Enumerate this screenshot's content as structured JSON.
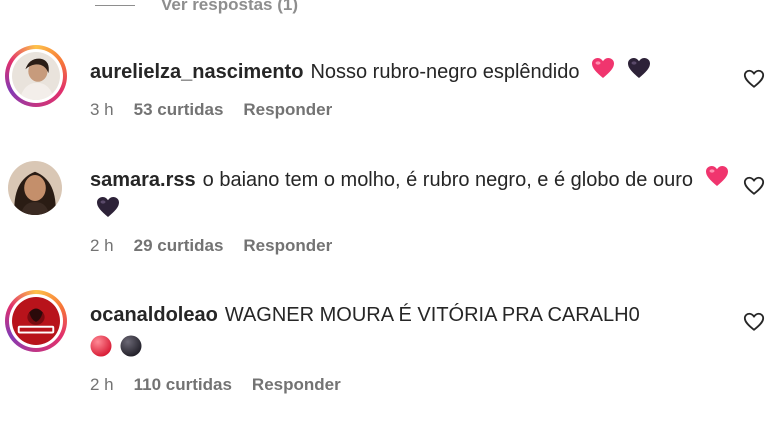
{
  "top": {
    "view_replies": "Ver respostas (1)"
  },
  "comments": [
    {
      "username": "aurelielza_nascimento",
      "text": "Nosso rubro-negro esplêndido",
      "emojis": [
        "pink-heart-icon",
        "black-heart-icon"
      ],
      "time": "3 h",
      "likes": "53 curtidas",
      "reply_label": "Responder",
      "has_story_ring": true
    },
    {
      "username": "samara.rss",
      "text": "o baiano tem o molho, é rubro negro, e é globo de ouro",
      "emojis": [
        "pink-heart-icon",
        "black-heart-icon"
      ],
      "time": "2 h",
      "likes": "29 curtidas",
      "reply_label": "Responder",
      "has_story_ring": false
    },
    {
      "username": "ocanaldoleao",
      "text": "WAGNER MOURA É VITÓRIA PRA CARALH0",
      "emojis": [
        "red-circle-icon",
        "black-circle-icon"
      ],
      "time": "2 h",
      "likes": "110 curtidas",
      "reply_label": "Responder",
      "has_story_ring": true
    }
  ],
  "colors": {
    "pink_heart": "#f0356e",
    "black_heart": "#2d2238",
    "red_circle": "#e8334a",
    "black_circle": "#2c2a33",
    "meta_text": "#737373"
  }
}
